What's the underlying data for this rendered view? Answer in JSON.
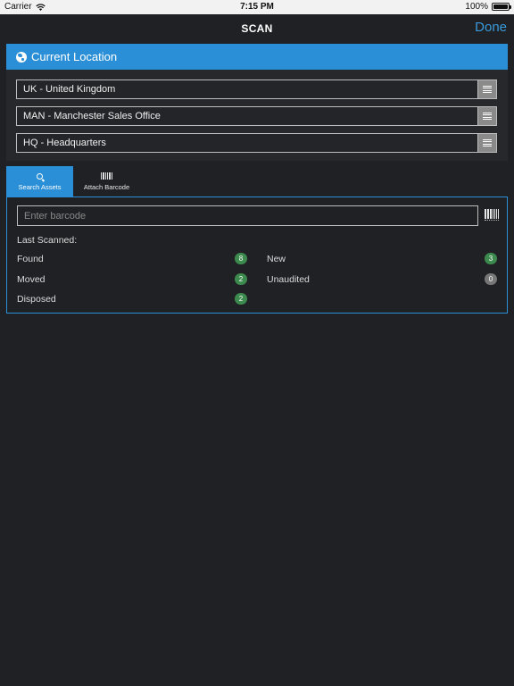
{
  "status_bar": {
    "carrier": "Carrier",
    "time": "7:15 PM",
    "battery": "100%"
  },
  "nav": {
    "title": "SCAN",
    "done": "Done"
  },
  "location": {
    "header": "Current Location",
    "fields": [
      {
        "value": "UK - United Kingdom"
      },
      {
        "value": "MAN - Manchester Sales Office"
      },
      {
        "value": "HQ - Headquarters"
      }
    ]
  },
  "tabs": [
    {
      "label": "Search Assets",
      "icon": "search-icon",
      "active": true
    },
    {
      "label": "Attach Barcode",
      "icon": "barcode-icon",
      "active": false
    }
  ],
  "scan": {
    "placeholder": "Enter barcode",
    "last_scanned_label": "Last Scanned:",
    "stats": {
      "found": {
        "label": "Found",
        "count": "8",
        "color": "#3c8a4d"
      },
      "new": {
        "label": "New",
        "count": "3",
        "color": "#3c8a4d"
      },
      "moved": {
        "label": "Moved",
        "count": "2",
        "color": "#3c8a4d"
      },
      "unaudited": {
        "label": "Unaudited",
        "count": "0",
        "color": "#777777"
      },
      "disposed": {
        "label": "Disposed",
        "count": "2",
        "color": "#3c8a4d"
      }
    }
  },
  "colors": {
    "accent": "#2a8fd6",
    "background": "#1f2125",
    "done_link": "#3a9ad9"
  }
}
